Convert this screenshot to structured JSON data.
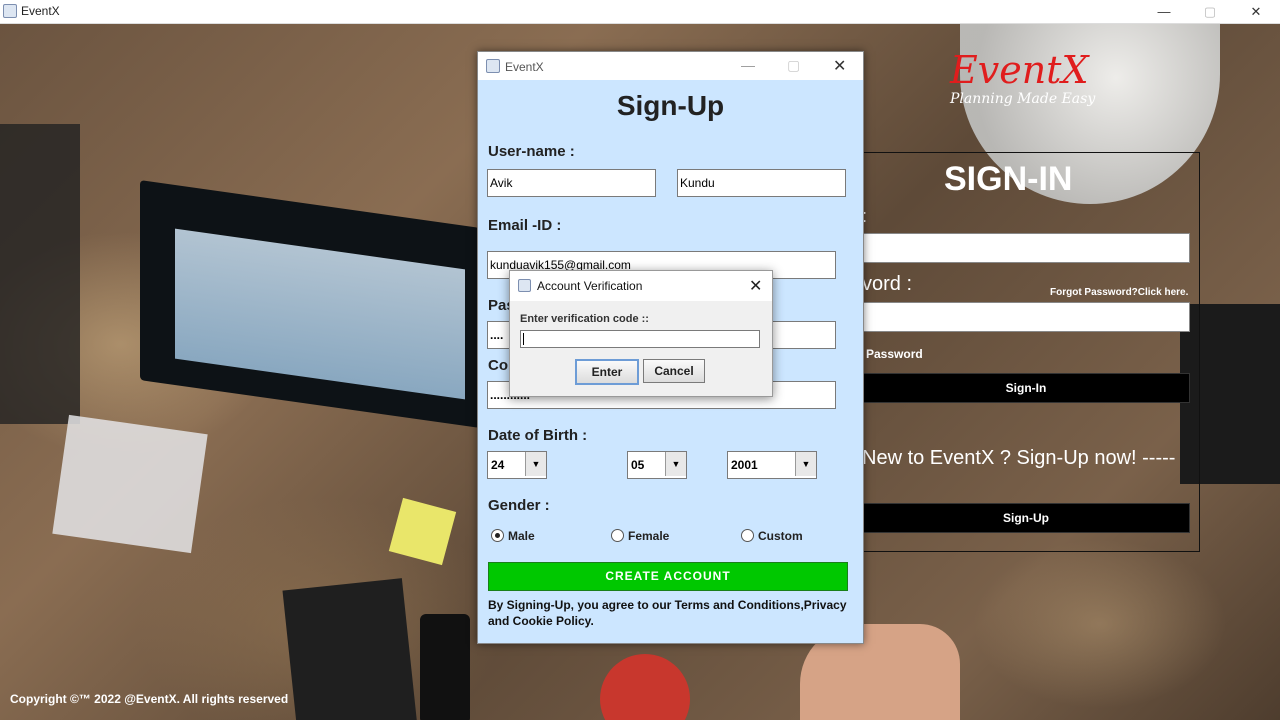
{
  "main_window": {
    "title": "EventX"
  },
  "background": {
    "copyright": "Copyright ©™ 2022 @EventX. All rights reserved"
  },
  "signin": {
    "brand": "EventX",
    "tagline": "Planning Made Easy",
    "title": "SIGN-IN",
    "user_label": ":",
    "password_label": "vord :",
    "forgot": "Forgot Password?Click here.",
    "show_password": "Password",
    "signin_button": "Sign-In",
    "new_to": "New to EventX ? Sign-Up now! -----",
    "signup_button": "Sign-Up"
  },
  "signup": {
    "window_title": "EventX",
    "heading": "Sign-Up",
    "username_label": "User-name :",
    "first_name": "Avik",
    "last_name": "Kundu",
    "email_label": "Email -ID :",
    "email": "kunduavik155@gmail.com",
    "password_label": "Pas",
    "password_value": "....",
    "confirm_label": "Co",
    "confirm_value": "............",
    "dob_label": "Date of Birth :",
    "dob_day": "24",
    "dob_month": "05",
    "dob_year": "2001",
    "gender_label": "Gender :",
    "gender_options": [
      "Male",
      "Female",
      "Custom"
    ],
    "gender_selected": "Male",
    "create_button": "CREATE  ACCOUNT",
    "terms": "By Signing-Up, you agree to our Terms and Conditions,Privacy and Cookie Policy."
  },
  "dialog": {
    "title": "Account Verification",
    "prompt": "Enter verification code ::",
    "input_value": "",
    "enter_button": "Enter",
    "cancel_button": "Cancel"
  },
  "icons": {
    "app": "java-cup-icon",
    "minimize": "minimize-icon",
    "maximize": "maximize-icon",
    "close": "close-icon",
    "dropdown": "chevron-down-icon"
  }
}
